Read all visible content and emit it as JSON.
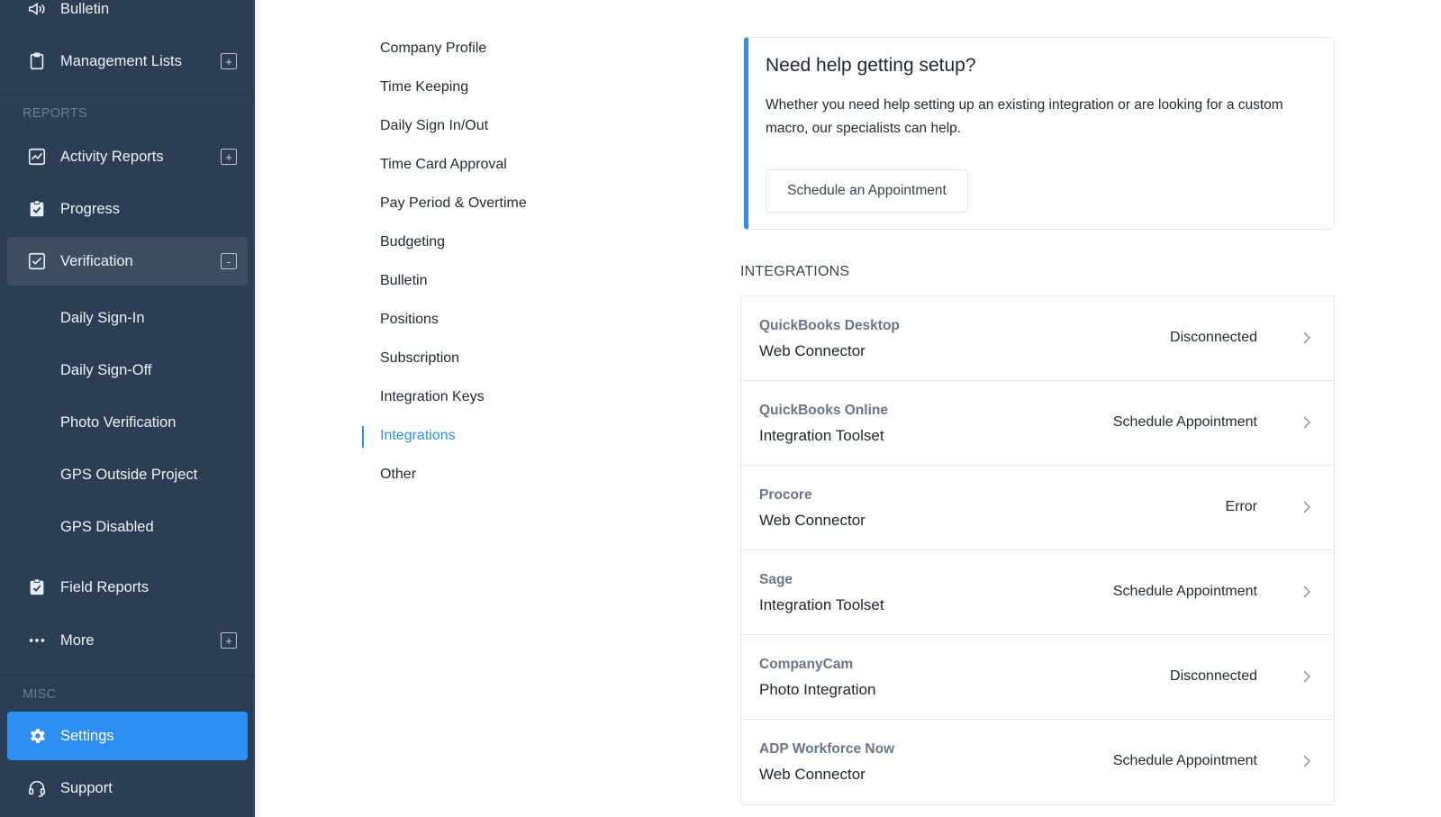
{
  "sidebar": {
    "items": [
      {
        "label": "Bulletin"
      },
      {
        "label": "Management Lists",
        "toggle": "+"
      },
      {
        "label": "Activity Reports",
        "toggle": "+"
      },
      {
        "label": "Progress"
      },
      {
        "label": "Verification",
        "toggle": "-"
      },
      {
        "label": "Field Reports"
      },
      {
        "label": "More",
        "toggle": "+"
      },
      {
        "label": "Settings"
      },
      {
        "label": "Support"
      }
    ],
    "sections": {
      "reports": "REPORTS",
      "misc": "MISC"
    },
    "verification_sub": [
      "Daily Sign-In",
      "Daily Sign-Off",
      "Photo Verification",
      "GPS Outside Project",
      "GPS Disabled"
    ]
  },
  "settings_nav": {
    "items": [
      "Company Profile",
      "Time Keeping",
      "Daily Sign In/Out",
      "Time Card Approval",
      "Pay Period & Overtime",
      "Budgeting",
      "Bulletin",
      "Positions",
      "Subscription",
      "Integration Keys",
      "Integrations",
      "Other"
    ],
    "current": "Integrations"
  },
  "help": {
    "title": "Need help getting setup?",
    "text": "Whether you need help setting up an existing integration or are looking for a custom macro, our specialists can help.",
    "button": "Schedule an Appointment"
  },
  "integrations": {
    "heading": "INTEGRATIONS",
    "rows": [
      {
        "name": "QuickBooks Desktop",
        "type": "Web Connector",
        "status": "Disconnected"
      },
      {
        "name": "QuickBooks Online",
        "type": "Integration Toolset",
        "status": "Schedule Appointment"
      },
      {
        "name": "Procore",
        "type": "Web Connector",
        "status": "Error"
      },
      {
        "name": "Sage",
        "type": "Integration Toolset",
        "status": "Schedule Appointment"
      },
      {
        "name": "CompanyCam",
        "type": "Photo Integration",
        "status": "Disconnected"
      },
      {
        "name": "ADP Workforce Now",
        "type": "Web Connector",
        "status": "Schedule Appointment"
      }
    ]
  },
  "colors": {
    "sidebar_bg": "#2c3e55",
    "accent": "#2f8ef4",
    "active_bg": "#3d4e63"
  },
  "icons": [
    "megaphone-icon",
    "clipboard-icon",
    "chart-icon",
    "clipboard-check-icon",
    "checkbox-icon",
    "ellipsis-icon",
    "gear-icon",
    "headset-icon",
    "chevron-right-icon"
  ]
}
